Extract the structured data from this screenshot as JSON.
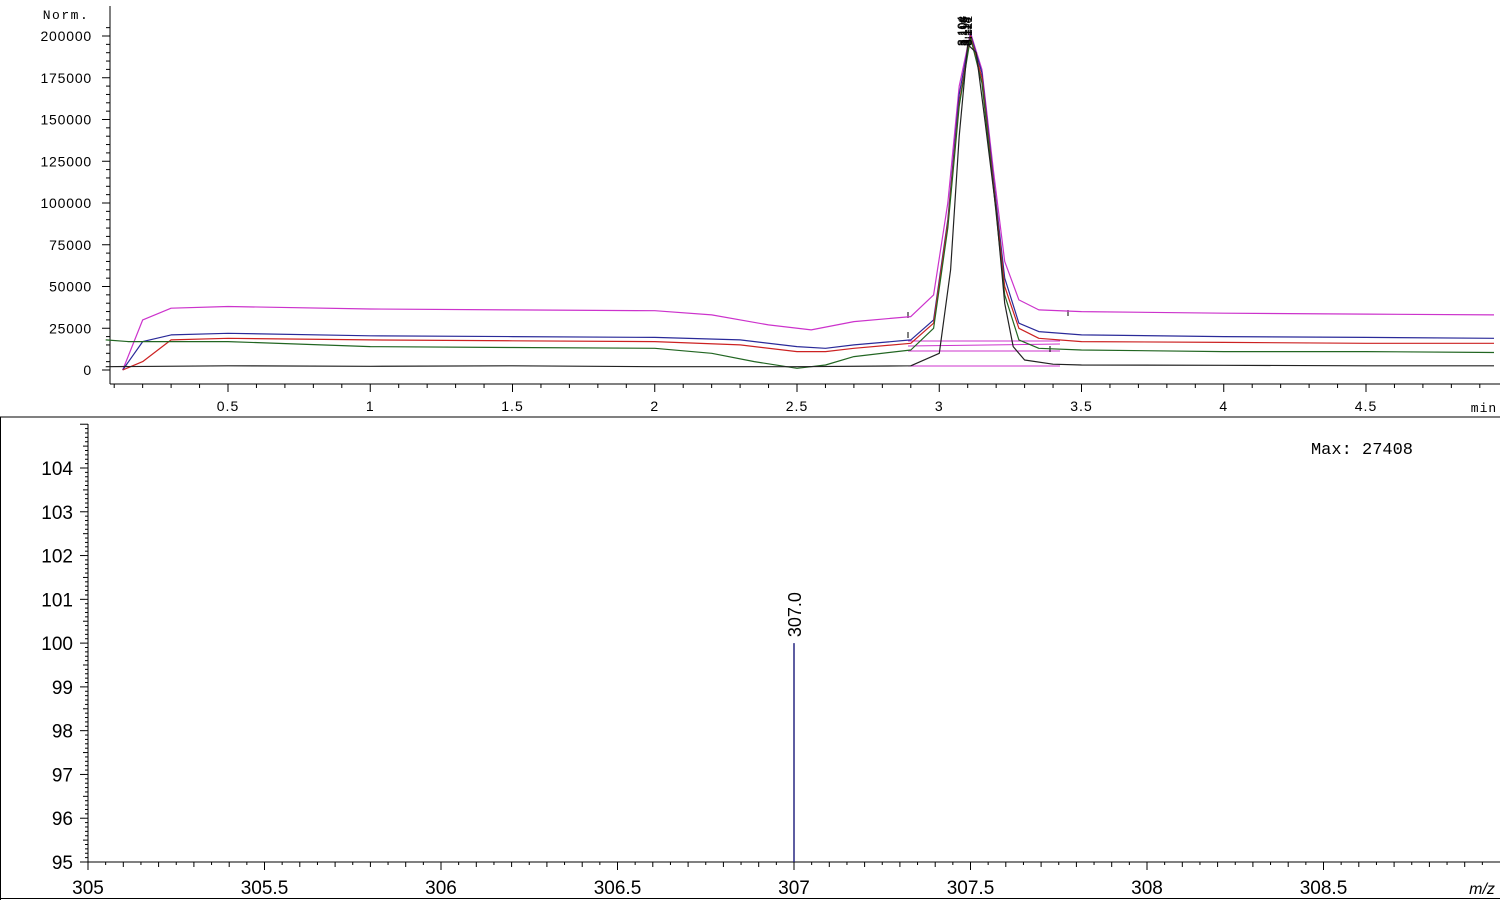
{
  "chromatogram": {
    "y_unit": "Norm.",
    "x_unit": "min",
    "peak_labels": [
      "3.104",
      "3.108",
      "3.112",
      "3.115",
      "3.118",
      "3.121"
    ]
  },
  "spectrum": {
    "x_unit": "m/z",
    "max_label": "Max: 27408",
    "peak_label": "307.0"
  },
  "chart_data": [
    {
      "type": "line",
      "title": "",
      "xlabel": "min",
      "ylabel": "Norm.",
      "xlim": [
        0.07,
        4.95
      ],
      "ylim": [
        -10000,
        207000
      ],
      "x_ticks": [
        0.5,
        1,
        1.5,
        2,
        2.5,
        3,
        3.5,
        4,
        4.5
      ],
      "x_tick_labels": [
        "0.5",
        "1",
        "1.5",
        "2",
        "2.5",
        "3",
        "3.5",
        "4",
        "4.5"
      ],
      "y_ticks": [
        0,
        25000,
        50000,
        75000,
        100000,
        125000,
        150000,
        175000,
        200000
      ],
      "y_tick_labels": [
        "0",
        "25000",
        "50000",
        "75000",
        "100000",
        "125000",
        "150000",
        "175000",
        "200000"
      ],
      "grid": false,
      "series": [
        {
          "color": "#cc33cc",
          "x": [
            0.13,
            0.2,
            0.3,
            0.5,
            1.0,
            1.5,
            2.0,
            2.2,
            2.4,
            2.55,
            2.7,
            2.9,
            2.98,
            3.03,
            3.07,
            3.11,
            3.15,
            3.19,
            3.23,
            3.28,
            3.35,
            3.5,
            4.0,
            4.5,
            4.95
          ],
          "y": [
            0,
            30000,
            37000,
            38000,
            36500,
            36000,
            35500,
            33000,
            27000,
            24000,
            29000,
            32000,
            45000,
            100000,
            170000,
            202000,
            180000,
            120000,
            65000,
            42000,
            36000,
            35000,
            34000,
            33500,
            33000
          ]
        },
        {
          "color": "#2a2a99",
          "x": [
            0.13,
            0.2,
            0.3,
            0.5,
            1.0,
            1.5,
            2.0,
            2.3,
            2.5,
            2.6,
            2.7,
            2.9,
            2.98,
            3.03,
            3.07,
            3.11,
            3.15,
            3.19,
            3.23,
            3.28,
            3.35,
            3.5,
            4.0,
            4.5,
            4.95
          ],
          "y": [
            0,
            17000,
            21000,
            22000,
            20500,
            20000,
            19500,
            18000,
            14000,
            13000,
            15000,
            18000,
            30000,
            90000,
            165000,
            201000,
            178000,
            115000,
            55000,
            28000,
            23000,
            21000,
            20000,
            19500,
            19000
          ]
        },
        {
          "color": "#cc2222",
          "x": [
            0.13,
            0.2,
            0.3,
            0.5,
            1.0,
            1.5,
            2.0,
            2.3,
            2.5,
            2.6,
            2.7,
            2.9,
            2.98,
            3.03,
            3.07,
            3.11,
            3.15,
            3.19,
            3.23,
            3.28,
            3.35,
            3.5,
            4.0,
            4.5,
            4.95
          ],
          "y": [
            0,
            5000,
            18000,
            19000,
            18000,
            17500,
            17000,
            15000,
            11000,
            11000,
            13000,
            16000,
            28000,
            88000,
            160000,
            200000,
            175000,
            112000,
            50000,
            25000,
            19000,
            17000,
            16500,
            16000,
            16000
          ]
        },
        {
          "color": "#226622",
          "x": [
            0.07,
            0.15,
            0.3,
            0.5,
            1.0,
            1.5,
            2.0,
            2.2,
            2.35,
            2.5,
            2.6,
            2.7,
            2.9,
            2.98,
            3.03,
            3.07,
            3.11,
            3.15,
            3.19,
            3.23,
            3.28,
            3.35,
            3.5,
            4.0,
            4.5,
            4.95
          ],
          "y": [
            18000,
            17000,
            17000,
            17000,
            14000,
            13500,
            13000,
            10000,
            5000,
            1000,
            3000,
            8000,
            12000,
            25000,
            85000,
            158000,
            199000,
            172000,
            110000,
            45000,
            18000,
            13000,
            12000,
            11000,
            11000,
            10500
          ]
        },
        {
          "color": "#222222",
          "x": [
            0.07,
            0.5,
            1.0,
            1.5,
            2.0,
            2.5,
            2.9,
            3.0,
            3.04,
            3.07,
            3.1,
            3.13,
            3.16,
            3.2,
            3.23,
            3.26,
            3.3,
            3.4,
            3.5,
            4.0,
            4.5,
            4.95
          ],
          "y": [
            2000,
            2500,
            2200,
            2500,
            2000,
            2000,
            2500,
            10000,
            60000,
            140000,
            195000,
            190000,
            150000,
            95000,
            40000,
            14000,
            6000,
            3500,
            3000,
            2800,
            2500,
            2500
          ]
        }
      ]
    },
    {
      "type": "bar",
      "title": "",
      "xlabel": "m/z",
      "ylabel": "",
      "xlim": [
        305,
        309
      ],
      "ylim": [
        95,
        105
      ],
      "x_ticks": [
        305,
        305.5,
        306,
        306.5,
        307,
        307.5,
        308,
        308.5
      ],
      "x_tick_labels": [
        "305",
        "305.5",
        "306",
        "306.5",
        "307",
        "307.5",
        "308",
        "308.5"
      ],
      "y_ticks": [
        95,
        96,
        97,
        98,
        99,
        100,
        101,
        102,
        103,
        104
      ],
      "y_tick_labels": [
        "95",
        "96",
        "97",
        "98",
        "99",
        "100",
        "101",
        "102",
        "103",
        "104"
      ],
      "grid": false,
      "peaks": [
        {
          "x": 307.0,
          "y": 100,
          "label": "307.0"
        }
      ],
      "annotation": "Max: 27408",
      "annotation_position": "top-right"
    }
  ]
}
